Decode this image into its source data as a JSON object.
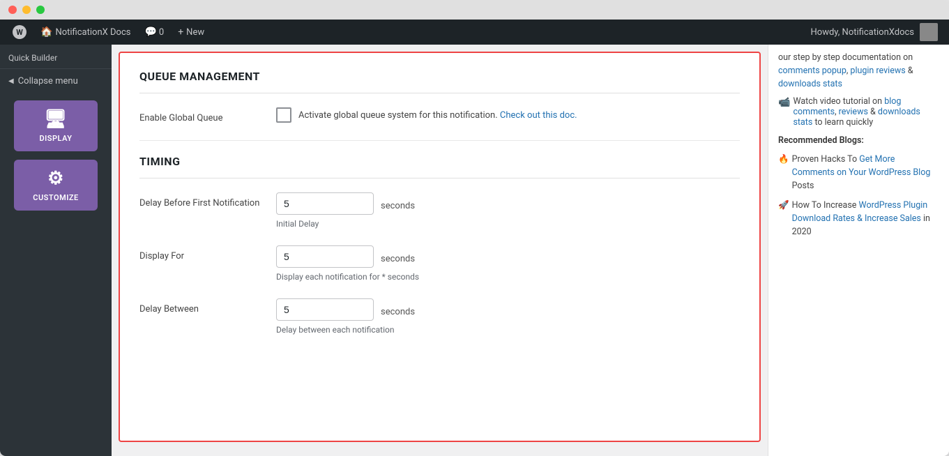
{
  "window": {
    "traffic_lights": [
      "red",
      "yellow",
      "green"
    ]
  },
  "admin_bar": {
    "wp_logo": "W",
    "site_name": "NotificationX Docs",
    "comments_label": "0",
    "new_label": "New",
    "howdy": "Howdy, NotificationXdocs"
  },
  "sidebar": {
    "quick_builder": "Quick Builder",
    "collapse_menu": "Collapse menu",
    "nav_items": [
      {
        "id": "display",
        "label": "DISPLAY",
        "icon": "🖥"
      },
      {
        "id": "customize",
        "label": "CUSTOMIZE",
        "icon": "⚙"
      }
    ]
  },
  "form": {
    "queue_section_title": "QUEUE MANAGEMENT",
    "enable_global_queue_label": "Enable Global Queue",
    "enable_global_queue_text": "Activate global queue system for this notification.",
    "check_out_link": "Check out this doc.",
    "timing_section_title": "TIMING",
    "delay_before_label": "Delay Before First Notification",
    "delay_before_value": "5",
    "delay_before_unit": "seconds",
    "delay_before_hint": "Initial Delay",
    "display_for_label": "Display For",
    "display_for_value": "5",
    "display_for_unit": "seconds",
    "display_for_hint": "Display each notification for * seconds",
    "delay_between_label": "Delay Between",
    "delay_between_value": "5",
    "delay_between_unit": "seconds",
    "delay_between_hint": "Delay between each notification"
  },
  "right_sidebar": {
    "intro_text": "our step by step documentation on",
    "links": {
      "comments_popup": "comments popup",
      "plugin_reviews": "plugin reviews",
      "downloads_stats": "downloads stats"
    },
    "ampersand": "&",
    "watch_text": "Watch video tutorial on",
    "blog_comments_link": "blog comments",
    "reviews_link": "reviews",
    "downloads_stats_link": "downloads stats",
    "learn_quickly_text": "to learn quickly",
    "recommended_heading": "Recommended Blogs:",
    "blog1_emoji": "🔥",
    "blog1_text": "Proven Hacks To",
    "blog1_link": "Get More Comments on Your WordPress Blog",
    "blog1_suffix": "Posts",
    "blog2_emoji": "🚀",
    "blog2_text": "How To Increase",
    "blog2_link": "WordPress Plugin Download Rates & Increase Sales",
    "blog2_suffix": "in 2020"
  }
}
